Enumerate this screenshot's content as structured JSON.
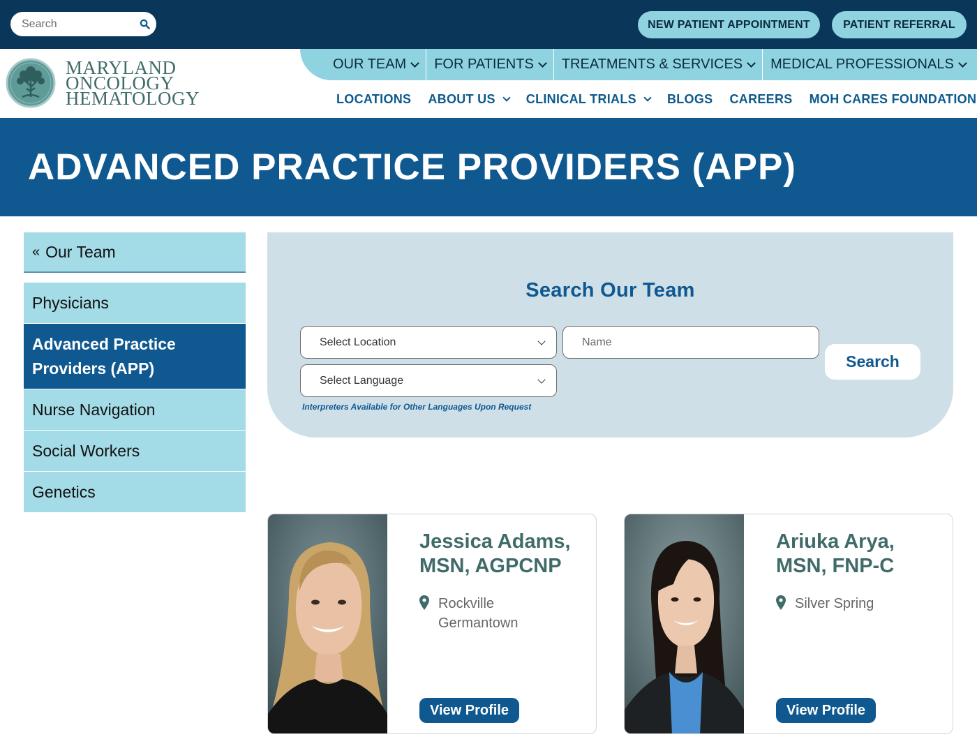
{
  "topbar": {
    "search_placeholder": "Search",
    "new_patient_label": "NEW PATIENT APPOINTMENT",
    "referral_label": "PATIENT REFERRAL"
  },
  "logo": {
    "line1": "MARYLAND",
    "line2": "ONCOLOGY",
    "line3": "HEMATOLOGY"
  },
  "primary_nav": [
    {
      "label": "OUR TEAM",
      "icon": "chevron-down-icon"
    },
    {
      "label": "FOR PATIENTS",
      "icon": "chevron-down-icon"
    },
    {
      "label": "TREATMENTS & SERVICES",
      "icon": "chevron-down-icon"
    },
    {
      "label": "MEDICAL PROFESSIONALS",
      "icon": "chevron-down-icon"
    }
  ],
  "secondary_nav": [
    {
      "label": "LOCATIONS"
    },
    {
      "label": "ABOUT US",
      "icon": "chevron-down-icon"
    },
    {
      "label": "CLINICAL TRIALS",
      "icon": "chevron-down-icon"
    },
    {
      "label": "BLOGS"
    },
    {
      "label": "CAREERS"
    },
    {
      "label": "MOH CARES FOUNDATION"
    }
  ],
  "hero": {
    "title": "ADVANCED PRACTICE PROVIDERS (APP)"
  },
  "sidebar": {
    "back_glyph": "«",
    "back_label": "Our Team",
    "items": [
      {
        "label": "Physicians",
        "active": false
      },
      {
        "label": "Advanced Practice Providers (APP)",
        "active": true
      },
      {
        "label": "Nurse Navigation",
        "active": false
      },
      {
        "label": "Social Workers",
        "active": false
      },
      {
        "label": "Genetics",
        "active": false
      }
    ]
  },
  "search_panel": {
    "title": "Search Our Team",
    "location_select": "Select Location",
    "name_placeholder": "Name",
    "language_select": "Select Language",
    "search_button": "Search",
    "note": "Interpreters Available for Other Languages Upon Request"
  },
  "providers": [
    {
      "name": "Jessica Adams, MSN, AGPCNP",
      "locations": [
        "Rockville",
        "Germantown"
      ],
      "button": "View Profile"
    },
    {
      "name": "Ariuka Arya, MSN, FNP-C",
      "locations": [
        "Silver Spring"
      ],
      "button": "View Profile"
    }
  ],
  "colors": {
    "topbar_bg": "#0a3659",
    "accent_light": "#8fd3e0",
    "primary_blue": "#0f5890",
    "sidebar_bg": "#a3dbe6",
    "panel_bg": "#cfdfe8",
    "provider_name": "#3f6b68"
  }
}
